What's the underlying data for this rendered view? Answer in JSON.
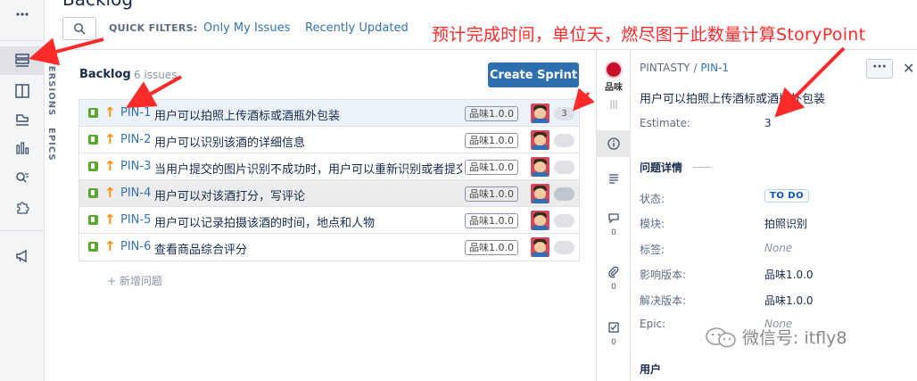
{
  "page": {
    "title": "Backlog"
  },
  "quick_filters": {
    "label": "QUICK FILTERS:",
    "items": [
      "Only My Issues",
      "Recently Updated"
    ]
  },
  "sidebar_tabs": {
    "versions": "VERSIONS",
    "epics": "EPICS"
  },
  "backlog": {
    "title": "Backlog",
    "count": "6 issues",
    "create_sprint": "Create Sprint",
    "new_issue": "+ 新增问题",
    "issues": [
      {
        "key": "PIN-1",
        "summary": "用户可以拍照上传酒标或酒瓶外包装",
        "version": "品味1.0.0",
        "estimate": "3"
      },
      {
        "key": "PIN-2",
        "summary": "用户可以识别该酒的详细信息",
        "version": "品味1.0.0",
        "estimate": ""
      },
      {
        "key": "PIN-3",
        "summary": "当用户提交的图片识别不成功时，用户可以重新识别或者提交",
        "version": "品味1.0.0",
        "estimate": ""
      },
      {
        "key": "PIN-4",
        "summary": "用户可以对该酒打分，写评论",
        "version": "品味1.0.0",
        "estimate": ""
      },
      {
        "key": "PIN-5",
        "summary": "用户可以记录拍摄该酒的时间，地点和人物",
        "version": "品味1.0.0",
        "estimate": ""
      },
      {
        "key": "PIN-6",
        "summary": "查看商品综合评分",
        "version": "品味1.0.0",
        "estimate": ""
      }
    ]
  },
  "detail": {
    "project_logo_text": "品味",
    "breadcrumb_project": "PINTASTY",
    "breadcrumb_sep": " / ",
    "breadcrumb_issue": "PIN-1",
    "summary": "用户可以拍照上传酒标或酒瓶外包装",
    "estimate_label": "Estimate:",
    "estimate_value": "3",
    "section_title": "问题详情",
    "fields": {
      "status_label": "状态:",
      "status_value": "TO DO",
      "module_label": "模块:",
      "module_value": "拍照识别",
      "tags_label": "标签:",
      "tags_value": "None",
      "affects_label": "影响版本:",
      "affects_value": "品味1.0.0",
      "fix_label": "解决版本:",
      "fix_value": "品味1.0.0",
      "epic_label": "Epic:",
      "epic_value": "None"
    },
    "user_section": "用户",
    "counts": {
      "comments": "0",
      "attachments": "0",
      "checklist": "0"
    }
  },
  "annotation": "预计完成时间，单位天，燃尽图于此数量计算StoryPoint",
  "watermark": "微信号: itfly8",
  "colors": {
    "accent": "#2e6fb0",
    "link": "#3572b0",
    "annotation": "#ff2a2a",
    "story_icon": "#5aa82f",
    "priority": "#ff8b00"
  }
}
